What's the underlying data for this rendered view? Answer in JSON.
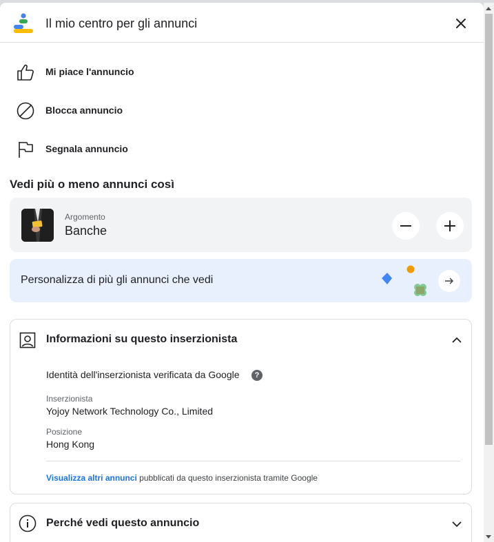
{
  "header": {
    "title": "Il mio centro per gli annunci"
  },
  "actions": [
    {
      "label": "Mi piace l'annuncio",
      "icon": "thumbs-up-icon"
    },
    {
      "label": "Blocca annuncio",
      "icon": "block-icon"
    },
    {
      "label": "Segnala annuncio",
      "icon": "flag-icon"
    }
  ],
  "preferences": {
    "title": "Vedi più o meno annunci così",
    "topic": {
      "kind": "Argomento",
      "name": "Banche"
    }
  },
  "personalize": {
    "label": "Personalizza di più gli annunci che vedi"
  },
  "advertiser": {
    "title": "Informazioni su questo inserzionista",
    "verified_text": "Identità dell'inserzionista verificata da Google",
    "help_glyph": "?",
    "advertiser_label": "Inserzionista",
    "advertiser_name": "Yojoy Network Technology Co., Limited",
    "location_label": "Posizione",
    "location_value": "Hong Kong",
    "more_ads_link": "Visualizza altri annunci",
    "more_ads_suffix": " pubblicati da questo inserzionista tramite Google"
  },
  "why": {
    "title": "Perché vedi questo annuncio"
  },
  "colors": {
    "accent_blue": "#1a73e8",
    "card_grey": "#f1f3f4",
    "personalize_bg": "#e8f0fe"
  }
}
